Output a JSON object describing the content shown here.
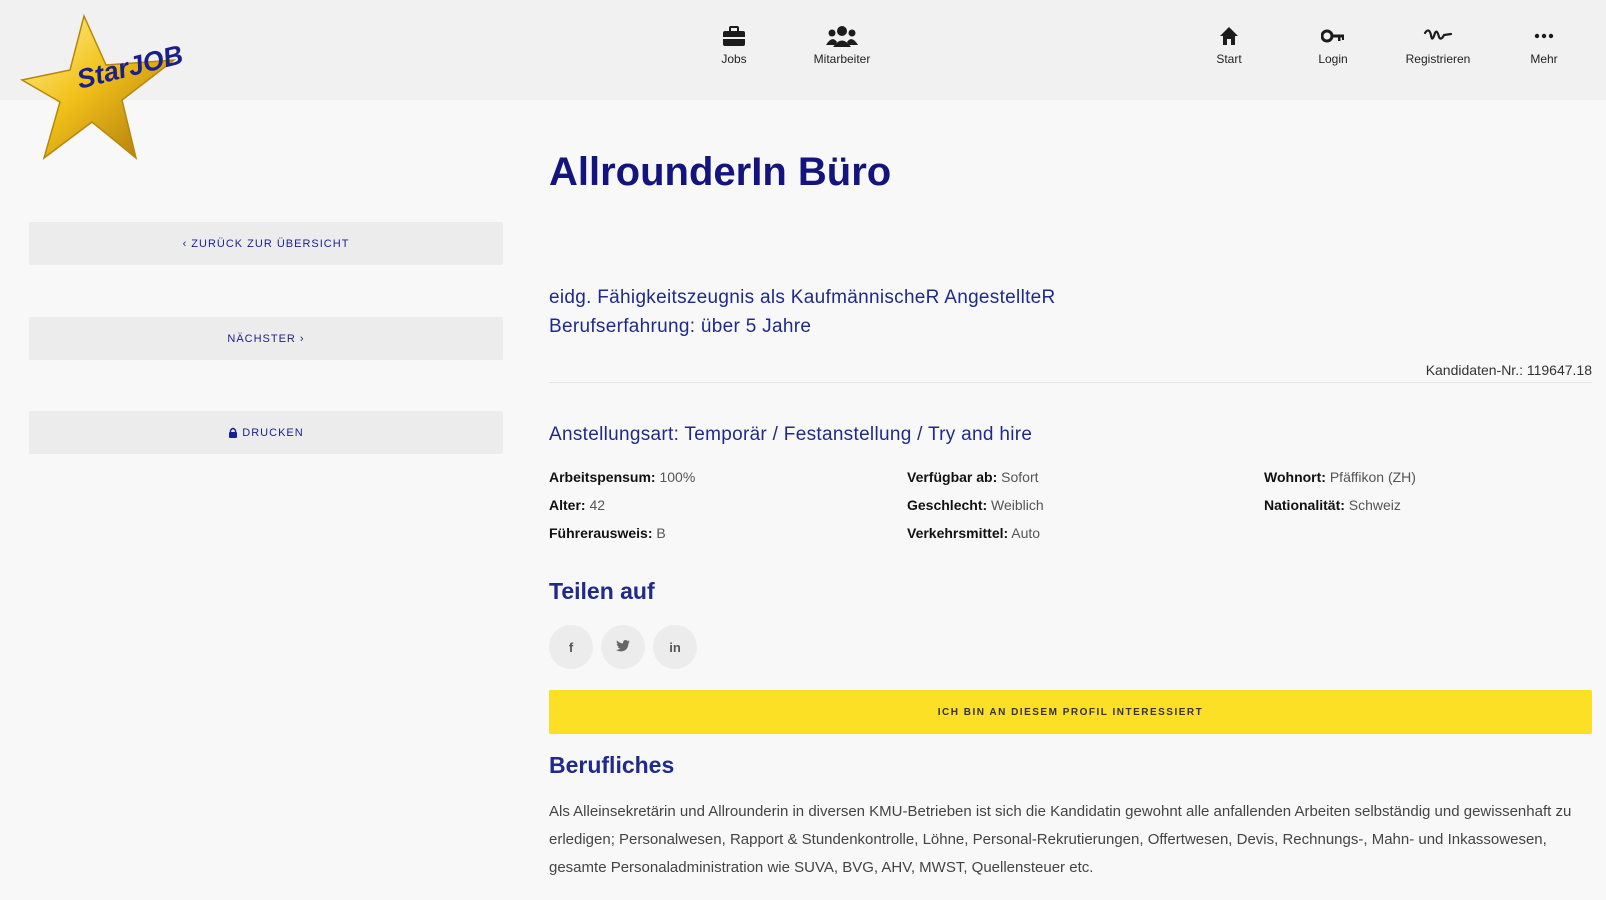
{
  "brand": {
    "logo_text": "StarJOB"
  },
  "nav": {
    "jobs": "Jobs",
    "mitarbeiter": "Mitarbeiter",
    "start": "Start",
    "login": "Login",
    "registrieren": "Registrieren",
    "mehr": "Mehr"
  },
  "sidebar": {
    "back": "‹ Zurück zur Übersicht",
    "next": "Nächster ›",
    "print": "Drucken"
  },
  "profile": {
    "title": "AllrounderIn Büro",
    "qualification": "eidg. Fähigkeitszeugnis als KaufmännischeR AngestellteR",
    "experience": "Berufserfahrung: über 5 Jahre",
    "candidate_no": "Kandidaten-Nr.: 119647.18",
    "employment_type": "Anstellungsart: Temporär / Festanstellung / Try and hire",
    "facts": {
      "pensum_label": "Arbeitspensum:",
      "pensum_value": "100%",
      "alter_label": "Alter:",
      "alter_value": "42",
      "fuehrer_label": "Führerausweis:",
      "fuehrer_value": "B",
      "verfuegbar_label": "Verfügbar ab:",
      "verfuegbar_value": "Sofort",
      "geschlecht_label": "Geschlecht:",
      "geschlecht_value": "Weiblich",
      "verkehr_label": "Verkehrsmittel:",
      "verkehr_value": "Auto",
      "wohnort_label": "Wohnort:",
      "wohnort_value": "Pfäffikon (ZH)",
      "nation_label": "Nationalität:",
      "nation_value": "Schweiz"
    }
  },
  "share": {
    "title": "Teilen auf",
    "facebook": "f",
    "twitter": "t",
    "linkedin": "in"
  },
  "cta": {
    "label": "Ich bin an diesem Profil interessiert"
  },
  "beruflich": {
    "title": "Berufliches",
    "text": "Als Alleinsekretärin und Allrounderin in diversen KMU-Betrieben ist sich die Kandidatin gewohnt alle anfallenden Arbeiten selbständig und gewissenhaft zu erledigen; Personalwesen, Rapport & Stundenkontrolle, Löhne, Personal-Rekrutierungen, Offertwesen, Devis, Rechnungs-, Mahn- und Inkassowesen, gesamte Personaladministration wie SUVA, BVG, AHV, MWST, Quellensteuer etc."
  },
  "colors": {
    "brand_blue": "#14147d",
    "accent_yellow": "#fbe025",
    "header_bg": "#f1f1f1",
    "button_bg": "#ececec"
  }
}
